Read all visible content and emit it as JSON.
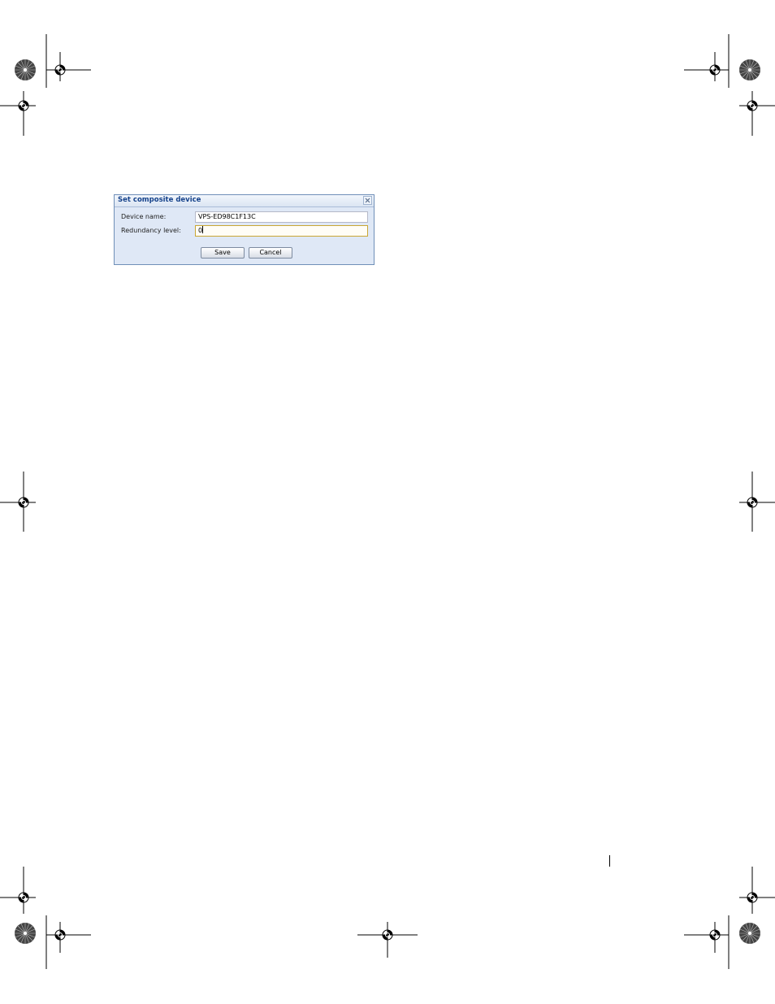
{
  "dialog": {
    "title": "Set composite device",
    "close_icon": "close-icon",
    "fields": [
      {
        "label": "Device name:",
        "value": "VPS-ED98C1F13C"
      },
      {
        "label": "Redundancy level:",
        "value": "0"
      }
    ],
    "buttons": {
      "save": "Save",
      "cancel": "Cancel"
    }
  },
  "colors": {
    "dialog_border": "#6f8fb8",
    "dialog_background": "#dfe8f6",
    "title_text": "#15428b",
    "focused_field_border": "#c9a634"
  }
}
